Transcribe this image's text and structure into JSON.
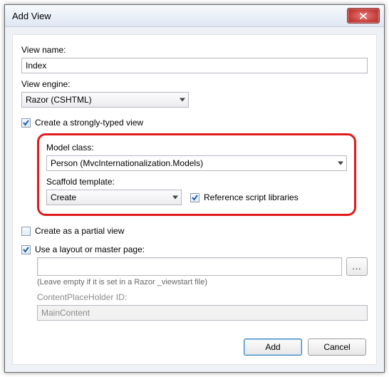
{
  "window": {
    "title": "Add View"
  },
  "fields": {
    "view_name_label": "View name:",
    "view_name_value": "Index",
    "view_engine_label": "View engine:",
    "view_engine_value": "Razor (CSHTML)"
  },
  "checkboxes": {
    "strongly_typed_label": "Create a strongly-typed view",
    "strongly_typed_checked": true,
    "partial_view_label": "Create as a partial view",
    "partial_view_checked": false,
    "use_layout_label": "Use a layout or master page:",
    "use_layout_checked": true,
    "ref_scripts_label": "Reference script libraries",
    "ref_scripts_checked": true
  },
  "model_box": {
    "model_class_label": "Model class:",
    "model_class_value": "Person (MvcInternationalization.Models)",
    "scaffold_template_label": "Scaffold template:",
    "scaffold_template_value": "Create"
  },
  "layout": {
    "path_value": "",
    "hint": "(Leave empty if it is set in a Razor _viewstart file)",
    "cph_label": "ContentPlaceHolder ID:",
    "cph_value": "MainContent",
    "browse_label": "..."
  },
  "buttons": {
    "add": "Add",
    "cancel": "Cancel"
  }
}
